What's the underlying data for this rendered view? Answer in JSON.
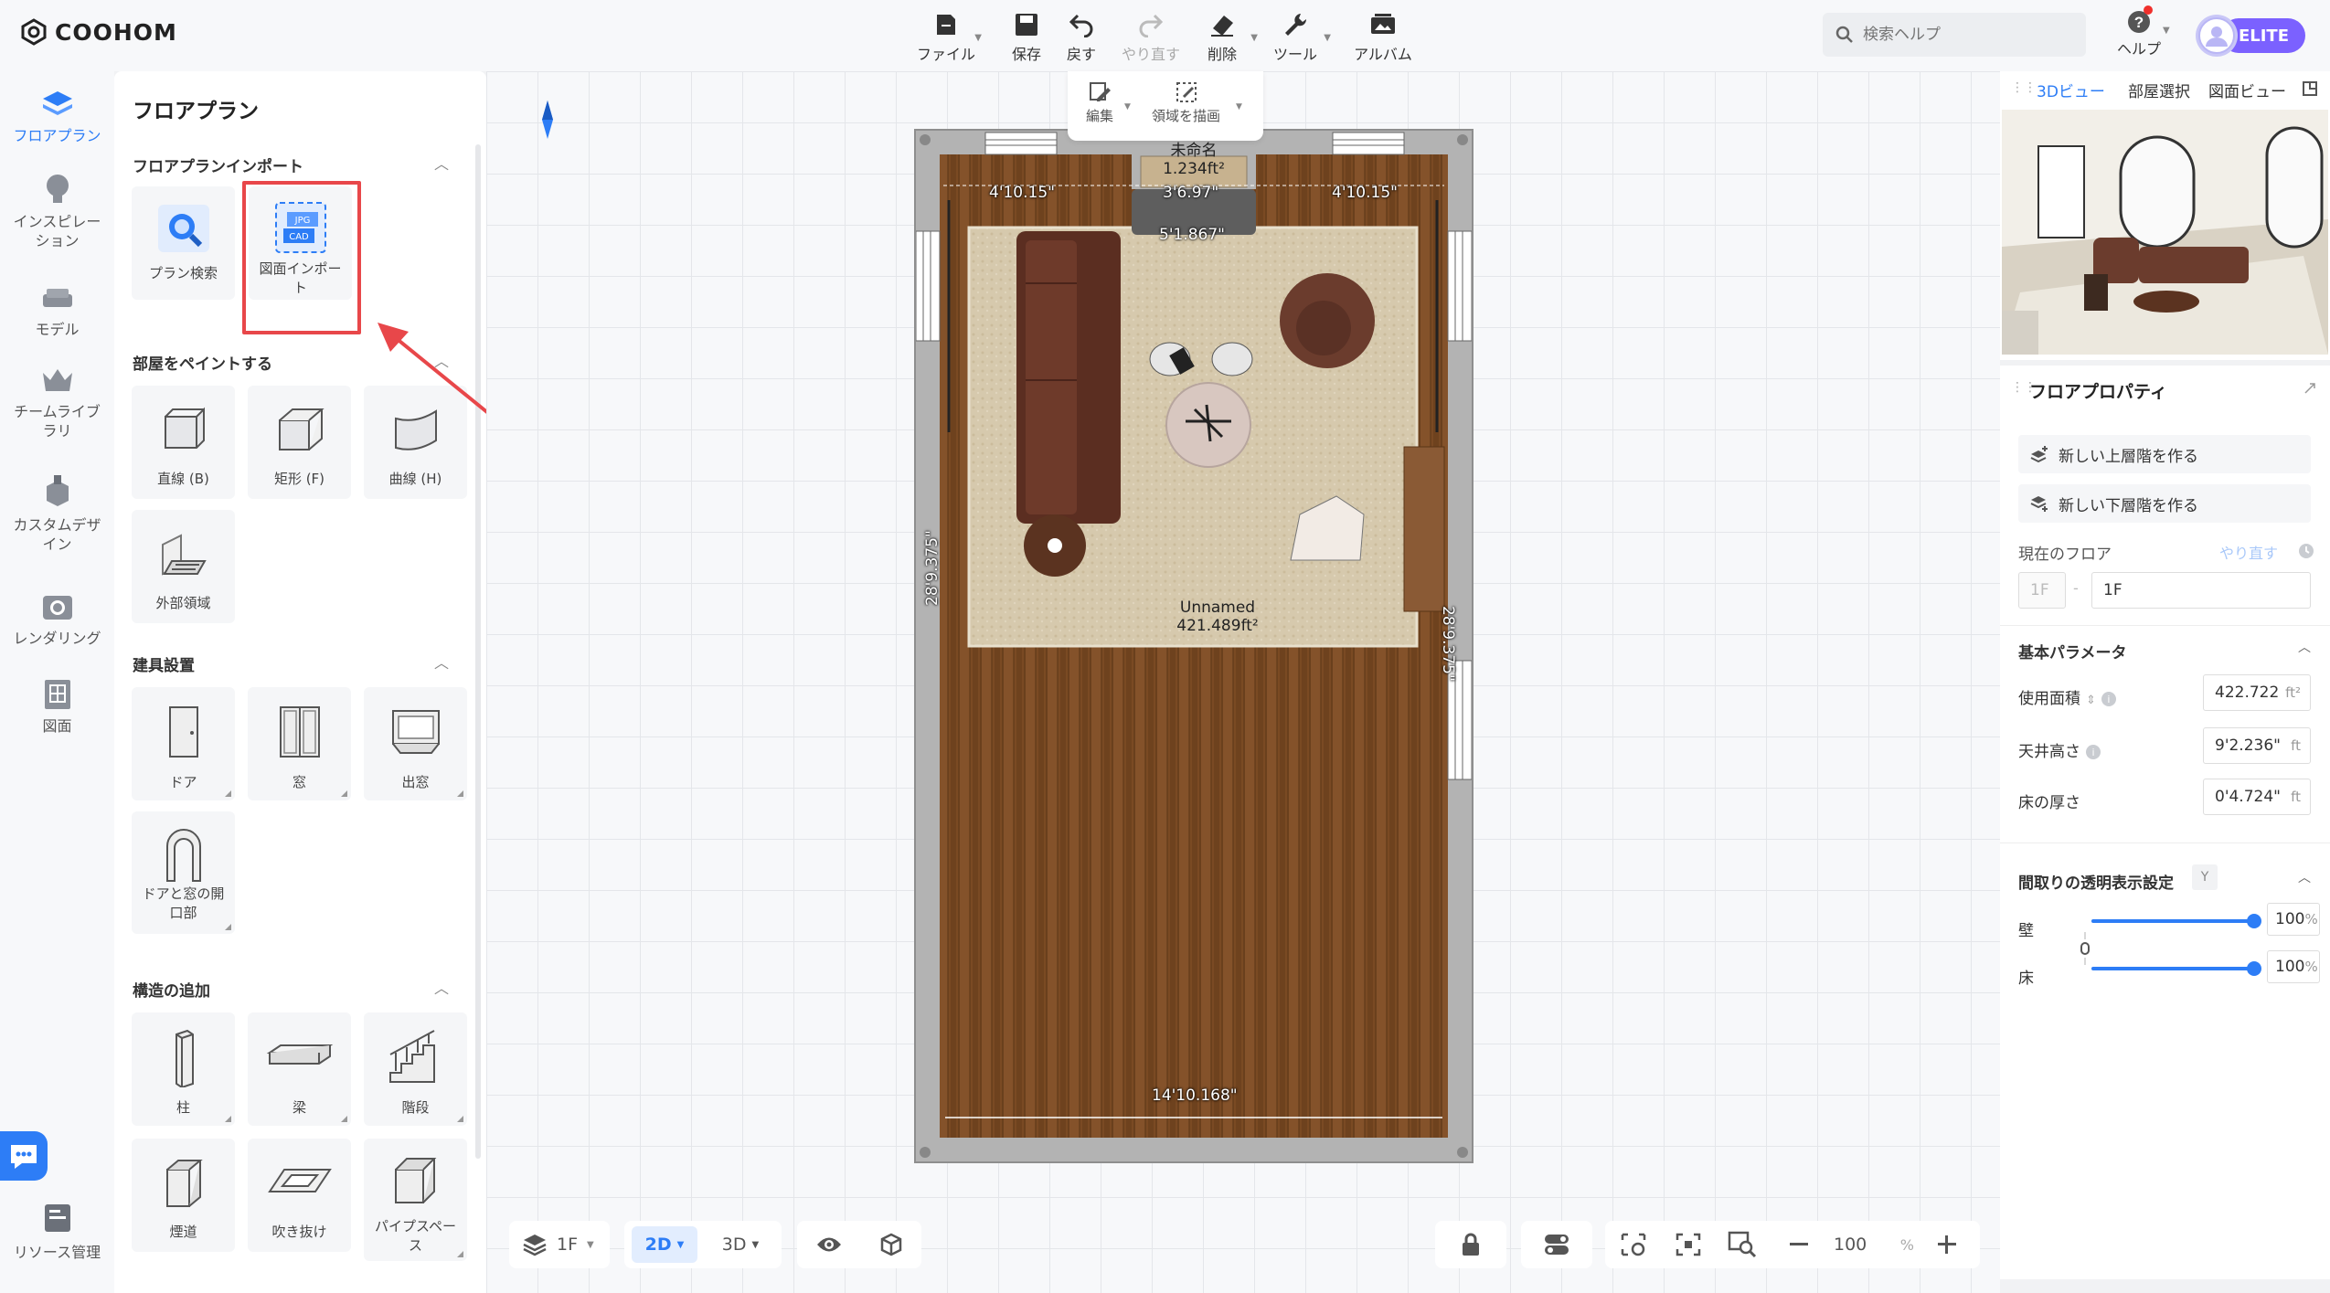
{
  "app": {
    "logo_text": "COOHOM"
  },
  "toolbar": [
    {
      "id": "file",
      "label": "ファイル",
      "icon": "file-icon",
      "caret": true,
      "disabled": false
    },
    {
      "id": "save",
      "label": "保存",
      "icon": "save-icon",
      "caret": false,
      "disabled": false
    },
    {
      "id": "undo",
      "label": "戻す",
      "icon": "undo-icon",
      "caret": false,
      "disabled": false
    },
    {
      "id": "redo",
      "label": "やり直す",
      "icon": "redo-icon",
      "caret": false,
      "disabled": true
    },
    {
      "id": "delete",
      "label": "削除",
      "icon": "eraser-icon",
      "caret": true,
      "disabled": false
    },
    {
      "id": "tools",
      "label": "ツール",
      "icon": "wrench-icon",
      "caret": true,
      "disabled": false
    },
    {
      "id": "album",
      "label": "アルバム",
      "icon": "album-icon",
      "caret": false,
      "disabled": false
    }
  ],
  "search": {
    "placeholder": "検索ヘルプ"
  },
  "help": {
    "label": "ヘルプ"
  },
  "badge": {
    "label": "ELITE",
    "color": "#7b61ff"
  },
  "leftnav": [
    {
      "label": "フロアプラン",
      "icon": "floorplan-icon",
      "active": true
    },
    {
      "label": "インスピレーション",
      "icon": "lightbulb-icon",
      "active": false
    },
    {
      "label": "モデル",
      "icon": "sofa-icon",
      "active": false
    },
    {
      "label": "チームライブラリ",
      "icon": "crown-icon",
      "active": false
    },
    {
      "label": "カスタムデザイン",
      "icon": "custom-design-icon",
      "active": false
    },
    {
      "label": "レンダリング",
      "icon": "camera-icon",
      "active": false
    },
    {
      "label": "図面",
      "icon": "drawing-icon",
      "active": false
    },
    {
      "label": "リソース管理",
      "icon": "resource-icon",
      "active": false
    }
  ],
  "panel": {
    "title": "フロアプラン",
    "sections": [
      {
        "title": "フロアプランインポート",
        "items": [
          {
            "label": "プラン検索",
            "icon": "plan-search-icon"
          },
          {
            "label": "図面インポート",
            "icon": "image-import-icon"
          }
        ]
      },
      {
        "title": "部屋をペイントする",
        "items": [
          {
            "label": "直線 (B)",
            "icon": "straight-wall-icon"
          },
          {
            "label": "矩形 (F)",
            "icon": "rect-room-icon"
          },
          {
            "label": "曲線 (H)",
            "icon": "curved-wall-icon"
          },
          {
            "label": "外部領域",
            "icon": "exterior-area-icon"
          }
        ]
      },
      {
        "title": "建具設置",
        "items": [
          {
            "label": "ドア",
            "icon": "door-icon"
          },
          {
            "label": "窓",
            "icon": "window-icon"
          },
          {
            "label": "出窓",
            "icon": "bay-window-icon"
          },
          {
            "label": "ドアと窓の開口部",
            "icon": "opening-icon"
          }
        ]
      },
      {
        "title": "構造の追加",
        "items": [
          {
            "label": "柱",
            "icon": "column-icon"
          },
          {
            "label": "梁",
            "icon": "beam-icon"
          },
          {
            "label": "階段",
            "icon": "stairs-icon"
          },
          {
            "label": "煙道",
            "icon": "flue-icon"
          },
          {
            "label": "吹き抜け",
            "icon": "void-icon"
          },
          {
            "label": "パイプスペース",
            "icon": "pipe-space-icon"
          }
        ]
      }
    ]
  },
  "canvas_tools": [
    {
      "label": "編集",
      "icon": "edit-icon"
    },
    {
      "label": "領域を描画",
      "icon": "draw-area-icon"
    }
  ],
  "plan": {
    "dimensions": {
      "top_left": "4'10.15\"",
      "top_mid": "3'6.97\"",
      "top_right": "4'10.15\"",
      "rug_top": "5'1.867\"",
      "left": "28'9.375\"",
      "right": "28'9.375\"",
      "bottom": "14'10.168\""
    },
    "room_small": {
      "name": "未命名",
      "area": "1.234ft²"
    },
    "room_main": {
      "name": "Unnamed",
      "area": "421.489ft²"
    }
  },
  "bottom": {
    "floor": "1F",
    "view_2d": "2D",
    "view_3d": "3D",
    "zoom": "100",
    "zoom_unit": "%"
  },
  "right": {
    "tabs": [
      "3Dビュー",
      "部屋選択",
      "図面ビュー"
    ],
    "props_title": "フロアプロパティ",
    "btn_up": "新しい上層階を作る",
    "btn_down": "新しい下層階を作る",
    "current_floor_label": "現在のフロア",
    "redo_label": "やり直す",
    "floor_left": "1F",
    "floor_value": "1F",
    "basic_title": "基本パラメータ",
    "area_label": "使用面積",
    "area_value": "422.722",
    "area_unit": "ft²",
    "ceiling_label": "天井高さ",
    "ceiling_value": "9'2.236\"",
    "ceiling_unit": "ft",
    "floor_thick_label": "床の厚さ",
    "floor_thick_value": "0'4.724\"",
    "floor_thick_unit": "ft",
    "transparency_title": "間取りの透明表示設定",
    "transparency_key": "Y",
    "wall_label": "壁",
    "wall_value": "100",
    "floor_label": "床",
    "floor_opacity_value": "100",
    "percent": "%"
  },
  "colors": {
    "accent": "#2d7df6",
    "highlight": "#e8474a",
    "wood": "#7a4a23",
    "rug": "#d8cbb0"
  }
}
